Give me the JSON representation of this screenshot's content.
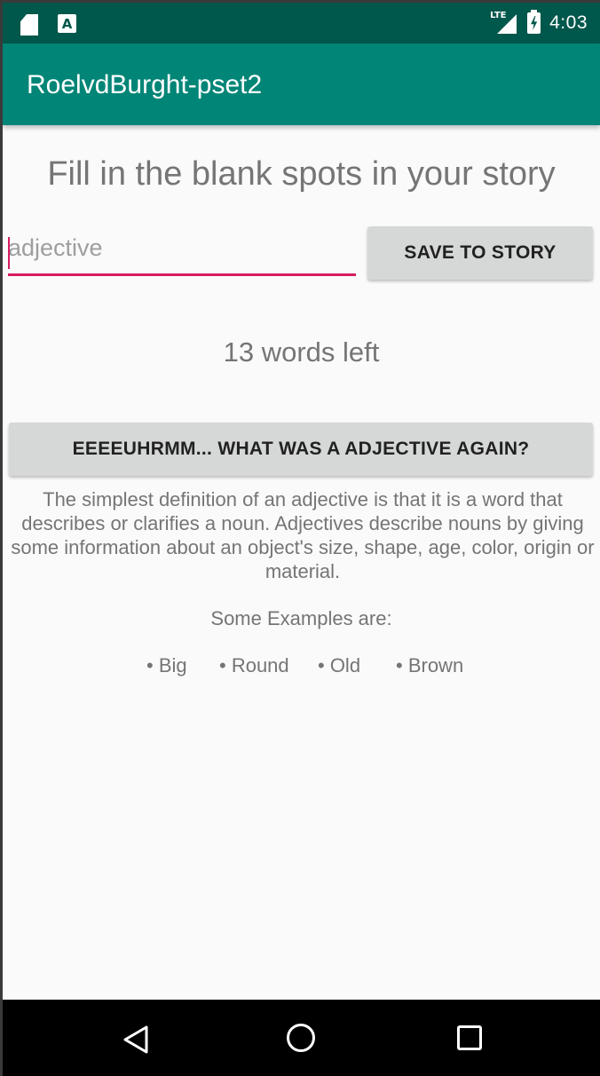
{
  "status_bar": {
    "time": "4:03",
    "network": "LTE",
    "icons": [
      "sd-card-icon",
      "a-notification-icon",
      "lte-signal-icon",
      "battery-charging-icon"
    ]
  },
  "app_bar": {
    "title": "RoelvdBurght-pset2",
    "color": "#008577"
  },
  "main": {
    "heading": "Fill in the blank spots in your story",
    "input": {
      "value": "",
      "placeholder": "adjective"
    },
    "save_button_label": "SAVE TO STORY",
    "words_left": "13 words left",
    "help_button_label": "EEEEUHRMM... WHAT WAS A ADJECTIVE AGAIN?",
    "definition": "The simplest definition of an adjective is that it is a word that describes or clarifies a noun. Adjectives describe nouns by giving some information about an object's size, shape, age, color, origin or material.",
    "examples_heading": "Some Examples are:",
    "examples": [
      "• Big",
      "• Round",
      "• Old",
      "• Brown"
    ]
  },
  "nav_bar": {
    "icons": [
      "back-icon",
      "home-icon",
      "recent-apps-icon"
    ]
  },
  "colors": {
    "accent": "#d81b60",
    "status_bar": "#00574b",
    "button": "#d6d7d7",
    "text_secondary": "#757575"
  }
}
